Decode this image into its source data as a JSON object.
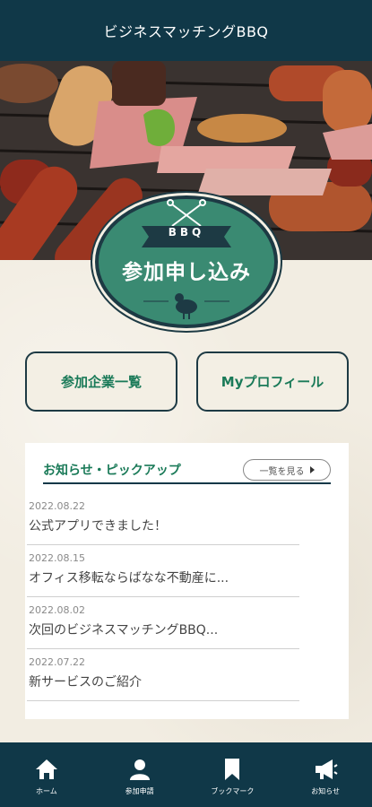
{
  "header": {
    "title": "ビジネスマッチングBBQ"
  },
  "badge": {
    "small_label": "BBQ",
    "title": "参加申し込み"
  },
  "buttons": {
    "companies": "参加企業一覧",
    "profile": "Myプロフィール"
  },
  "news": {
    "title": "お知らせ・ピックアップ",
    "more_label": "一覧を見る",
    "items": [
      {
        "date": "2022.08.22",
        "text": "公式アプリできました！"
      },
      {
        "date": "2022.08.15",
        "text": "オフィス移転ならばなな不動産に..."
      },
      {
        "date": "2022.08.02",
        "text": "次回のビジネスマッチングBBQ..."
      },
      {
        "date": "2022.07.22",
        "text": "新サービスのご紹介"
      }
    ]
  },
  "tabbar": {
    "items": [
      {
        "label": "ホーム",
        "icon": "home-icon"
      },
      {
        "label": "参加申請",
        "icon": "person-icon"
      },
      {
        "label": "ブックマーク",
        "icon": "bookmark-icon"
      },
      {
        "label": "お知らせ",
        "icon": "megaphone-icon"
      }
    ]
  },
  "colors": {
    "navy": "#103848",
    "accent_green": "#1a7a58",
    "badge_green": "#3a8a72"
  }
}
